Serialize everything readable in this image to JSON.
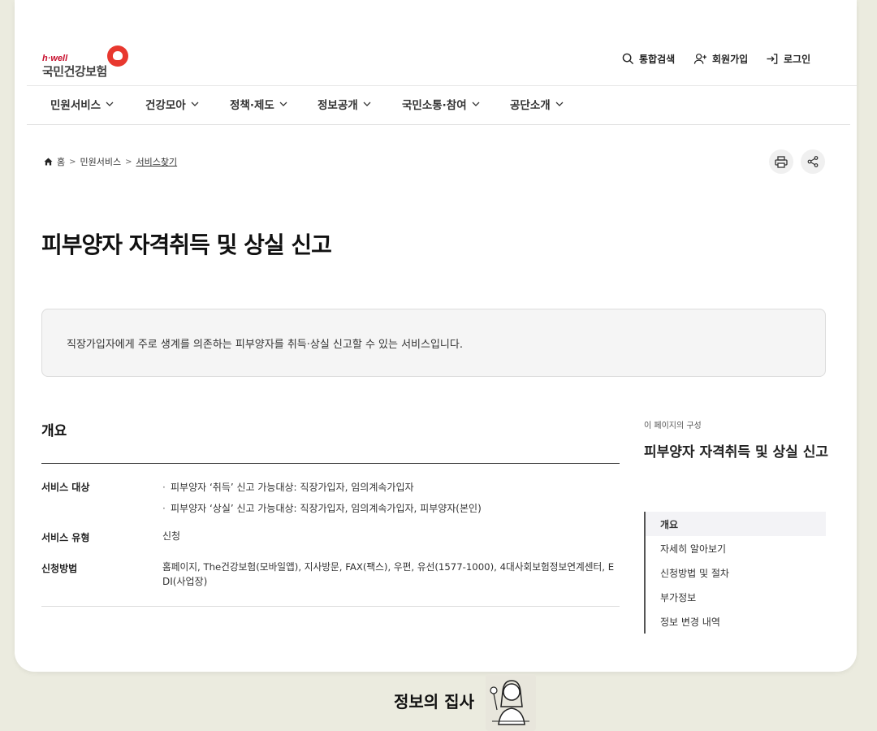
{
  "logo": {
    "tagline": "h·well",
    "name": "국민건강보험"
  },
  "utility": {
    "search": "통합검색",
    "join": "회원가입",
    "login": "로그인"
  },
  "gnb": [
    "민원서비스",
    "건강모아",
    "정책·제도",
    "정보공개",
    "국민소통·참여",
    "공단소개"
  ],
  "breadcrumb": {
    "home": "홈",
    "level1": "민원서비스",
    "current": "서비스찾기"
  },
  "page": {
    "title": "피부양자 자격취득 및 상실 신고",
    "summary": "직장가입자에게 주로 생계를 의존하는 피부양자를 취득·상실 신고할 수 있는 서비스입니다."
  },
  "overview": {
    "title": "개요",
    "target_label": "서비스 대상",
    "target_items": [
      "피부양자 ‘취득’ 신고 가능대상: 직장가입자, 임의계속가입자",
      "피부양자 ‘상실’ 신고 가능대상: 직장가입자, 임의계속가입자, 피부양자(본인)"
    ],
    "type_label": "서비스 유형",
    "type_value": "신청",
    "method_label": "신청방법",
    "method_line1": "홈페이지, The건강보험(모바일앱), 지사방문, FAX(팩스), 우편, 유선(1577-1000), 4대사회보험정보연계센터, E",
    "method_line2": "DI(사업장)"
  },
  "side": {
    "caption": "이 페이지의 구성",
    "title": "피부양자 자격취득 및 상실 신고",
    "items": [
      "개요",
      "자세히 알아보기",
      "신청방법 및 절차",
      "부가정보",
      "정보 변경 내역"
    ]
  },
  "footer": {
    "brand": "정보의 집사"
  },
  "colors": {
    "accent": "#e8382f",
    "background": "#ebebdf"
  }
}
